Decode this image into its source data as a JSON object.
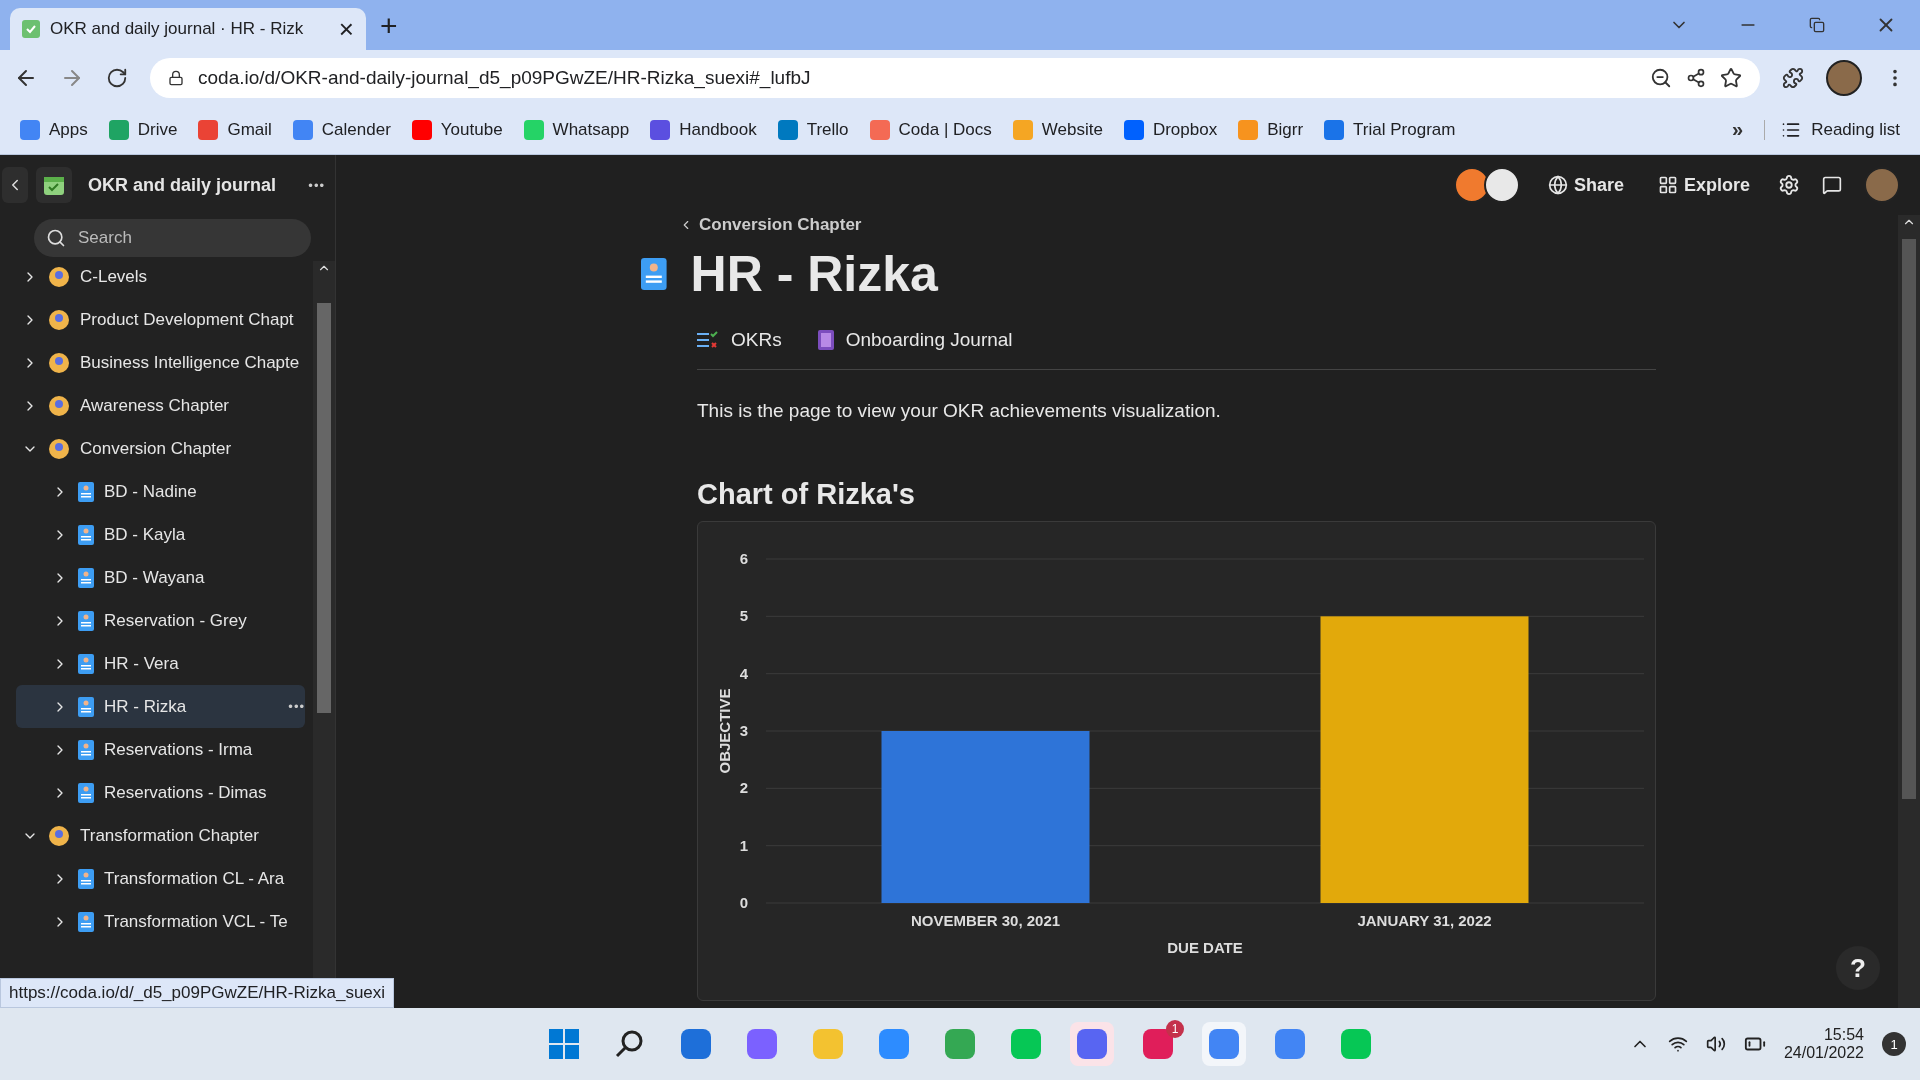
{
  "browser": {
    "tabs": [
      {
        "title": "OKR and daily journal · HR - Rizk",
        "close": "×",
        "selected": true
      }
    ],
    "new_tab": "+",
    "address": "coda.io/d/OKR-and-daily-journal_d5_p09PGwZE/HR-Rizka_suexi#_lufbJ",
    "bookmarks": [
      {
        "label": "Apps",
        "color": "#4285f4"
      },
      {
        "label": "Drive",
        "color": "#1fa463"
      },
      {
        "label": "Gmail",
        "color": "#ea4335"
      },
      {
        "label": "Calender",
        "color": "#4285f4"
      },
      {
        "label": "Youtube",
        "color": "#ff0000"
      },
      {
        "label": "Whatsapp",
        "color": "#25d366"
      },
      {
        "label": "Handbook",
        "color": "#5b4fe0"
      },
      {
        "label": "Trello",
        "color": "#0079bf"
      },
      {
        "label": "Coda | Docs",
        "color": "#f46a54"
      },
      {
        "label": "Website",
        "color": "#f5a623"
      },
      {
        "label": "Dropbox",
        "color": "#0061fe"
      },
      {
        "label": "Bigrr",
        "color": "#f7931e"
      },
      {
        "label": "Trial Program",
        "color": "#1a73e8"
      }
    ],
    "bookmarks_more": "»",
    "reading_list": "Reading list"
  },
  "doc": {
    "title": "OKR and daily journal",
    "more": "•••",
    "row_more": "•••",
    "sidebar": {
      "search": {
        "placeholder": "Search"
      },
      "tree": [
        {
          "label": "C-Levels",
          "expanded": false,
          "selected": false
        },
        {
          "label": "Product Development Chapt",
          "expanded": false,
          "selected": false
        },
        {
          "label": "Business Intelligence Chapte",
          "expanded": false,
          "selected": false
        },
        {
          "label": "Awareness Chapter",
          "expanded": false,
          "selected": false
        },
        {
          "label": "Conversion Chapter",
          "expanded": true,
          "selected": false,
          "children": [
            {
              "label": "BD - Nadine",
              "expanded": false,
              "selected": false
            },
            {
              "label": "BD - Kayla",
              "expanded": false,
              "selected": false
            },
            {
              "label": "BD - Wayana",
              "expanded": false,
              "selected": false
            },
            {
              "label": "Reservation - Grey",
              "expanded": false,
              "selected": false
            },
            {
              "label": "HR - Vera",
              "expanded": false,
              "selected": false
            },
            {
              "label": "HR - Rizka",
              "expanded": false,
              "selected": true
            },
            {
              "label": "Reservations - Irma",
              "expanded": false,
              "selected": false
            },
            {
              "label": "Reservations - Dimas",
              "expanded": false,
              "selected": false
            }
          ]
        },
        {
          "label": "Transformation Chapter",
          "expanded": true,
          "selected": false,
          "children": [
            {
              "label": "Transformation CL - Ara",
              "expanded": false,
              "selected": false
            },
            {
              "label": "Transformation VCL - Te",
              "expanded": false,
              "selected": false
            }
          ]
        }
      ]
    },
    "header": {
      "share": "Share",
      "explore": "Explore"
    },
    "page": {
      "breadcrumb": "Conversion Chapter",
      "title": "HR - Rizka",
      "subpages": [
        "OKRs",
        "Onboarding Journal"
      ],
      "description": "This is the page to view your OKR achievements visualization.",
      "chart_heading": "Chart of Rizka's",
      "chart_data": {
        "type": "bar",
        "xlabel": "DUE DATE",
        "ylabel": "OBJECTIVE",
        "categories": [
          "NOVEMBER 30, 2021",
          "JANUARY 31, 2022"
        ],
        "stacked": true,
        "grid": true,
        "ylim": [
          0,
          6
        ],
        "yticks": [
          0,
          1,
          2,
          3,
          4,
          5,
          6
        ],
        "series": [
          {
            "color": "#2e74d8",
            "values": [
              3,
              null
            ]
          },
          {
            "color": "#e2a90b",
            "values": [
              null,
              5
            ]
          }
        ]
      },
      "help": "?"
    }
  },
  "status_url": "https://coda.io/d/_d5_p09PGwZE/HR-Rizka_suexi",
  "taskbar": {
    "slack_badge": "1",
    "time": "15:54",
    "date": "24/01/2022",
    "notifications": "1"
  }
}
